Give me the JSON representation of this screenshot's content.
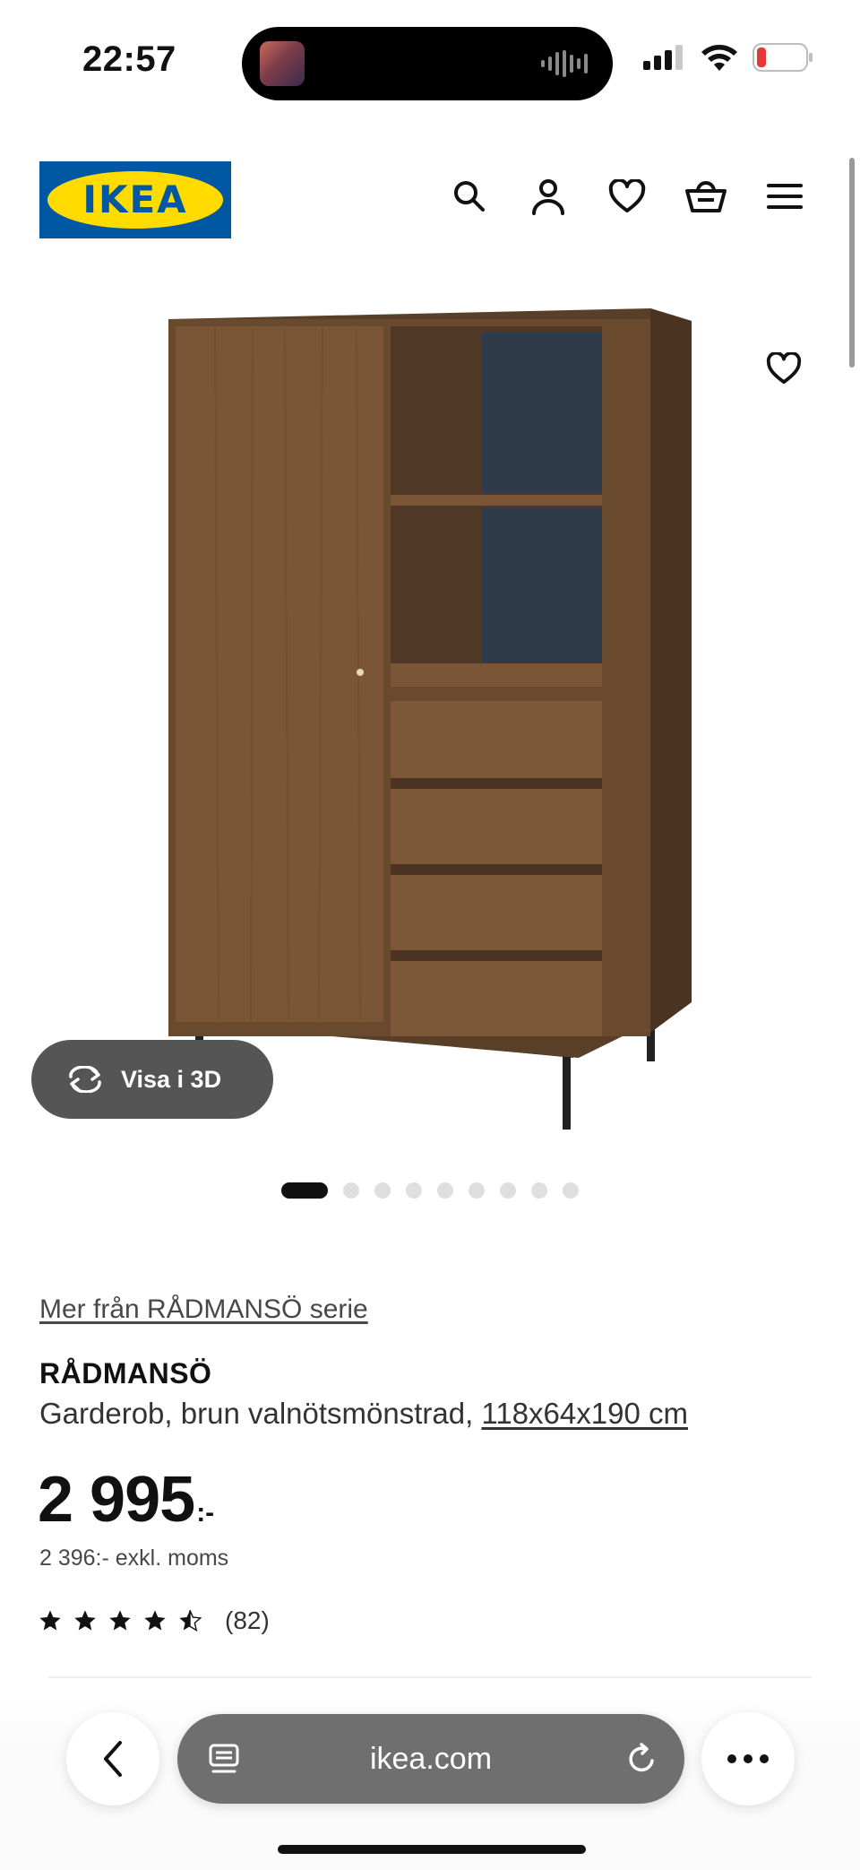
{
  "status_bar": {
    "time": "22:57",
    "battery_color": "#e53935"
  },
  "header": {
    "logo_text": "IKEA",
    "brand_colors": {
      "blue": "#0058a3",
      "yellow": "#ffdb00"
    },
    "icons": [
      "search-icon",
      "account-icon",
      "heart-icon",
      "basket-icon",
      "menu-icon"
    ]
  },
  "gallery": {
    "view_3d_label": "Visa i 3D",
    "image_count": 9,
    "active_index": 0
  },
  "product": {
    "series_link": "Mer från RÅDMANSÖ serie",
    "name": "RÅDMANSÖ",
    "description": "Garderob, brun valnötsmönstrad, ",
    "size": "118x64x190 cm",
    "price": "2 995",
    "price_suffix": ":-",
    "price_ex_vat": "2 396:- exkl. moms",
    "rating": 4.5,
    "rating_count": "(82)"
  },
  "browser": {
    "url": "ikea.com"
  }
}
